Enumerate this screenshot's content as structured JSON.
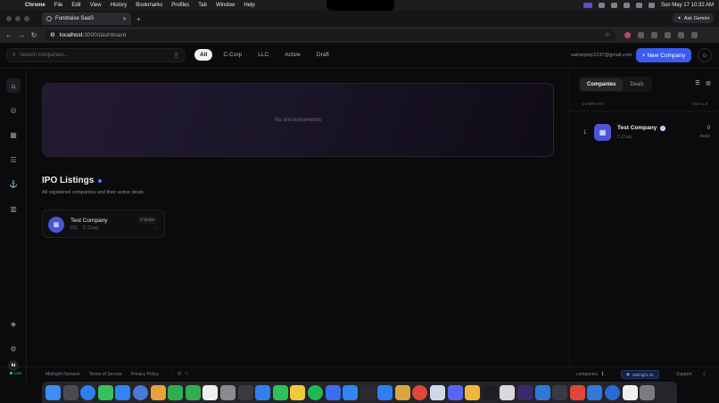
{
  "menubar": {
    "items": [
      "Chrome",
      "File",
      "Edit",
      "View",
      "History",
      "Bookmarks",
      "Profiles",
      "Tab",
      "Window",
      "Help"
    ],
    "clock": "Sun May 17  10:32 AM"
  },
  "browser": {
    "tab_title": "Fundraise SaaS",
    "ask_gemini": "Ask Gemini",
    "url_host": "localhost",
    "url_path": ":3000/dashboard"
  },
  "topbar": {
    "search_placeholder": "Search companies...",
    "search_shortcut": "/",
    "filters": [
      "All",
      "C-Corp",
      "LLC",
      "Active",
      "Draft"
    ],
    "active_filter": "All",
    "email": "samarpiqc1237@gmail.com",
    "new_company": "+ New Company"
  },
  "main": {
    "announcement_empty": "No announcements",
    "ipo_title": "IPO Listings",
    "ipo_subtitle": "All registered companies and their active deals",
    "listing": {
      "name": "Test Company",
      "code": "DS",
      "type": "C-Corp",
      "deals": "0 deals"
    }
  },
  "right_panel": {
    "tabs": [
      "Companies",
      "Deals"
    ],
    "col_company": "COMPANY",
    "col_deals": "DEALS",
    "row": {
      "rank": "1",
      "name": "Test Company",
      "type": "C-Corp",
      "deals": "0",
      "deals_label": "deals"
    }
  },
  "footer": {
    "live": "Live",
    "links": [
      "Midnight Network",
      "Terms of Service",
      "Privacy Policy"
    ],
    "companies_label": "companies",
    "companies_count": "1",
    "network": "Midnight 2K",
    "support": "Support"
  },
  "sidebar": {
    "avatar": "N"
  },
  "colors": {
    "accent": "#3a5cf0",
    "live": "#2fd66b",
    "background": "#0b0b0d"
  },
  "icons": {
    "sidebar": [
      "home-icon",
      "compass-icon",
      "calendar-icon",
      "list-icon",
      "anchor-icon",
      "bar-chart-icon",
      "layers-icon",
      "settings-icon"
    ]
  }
}
